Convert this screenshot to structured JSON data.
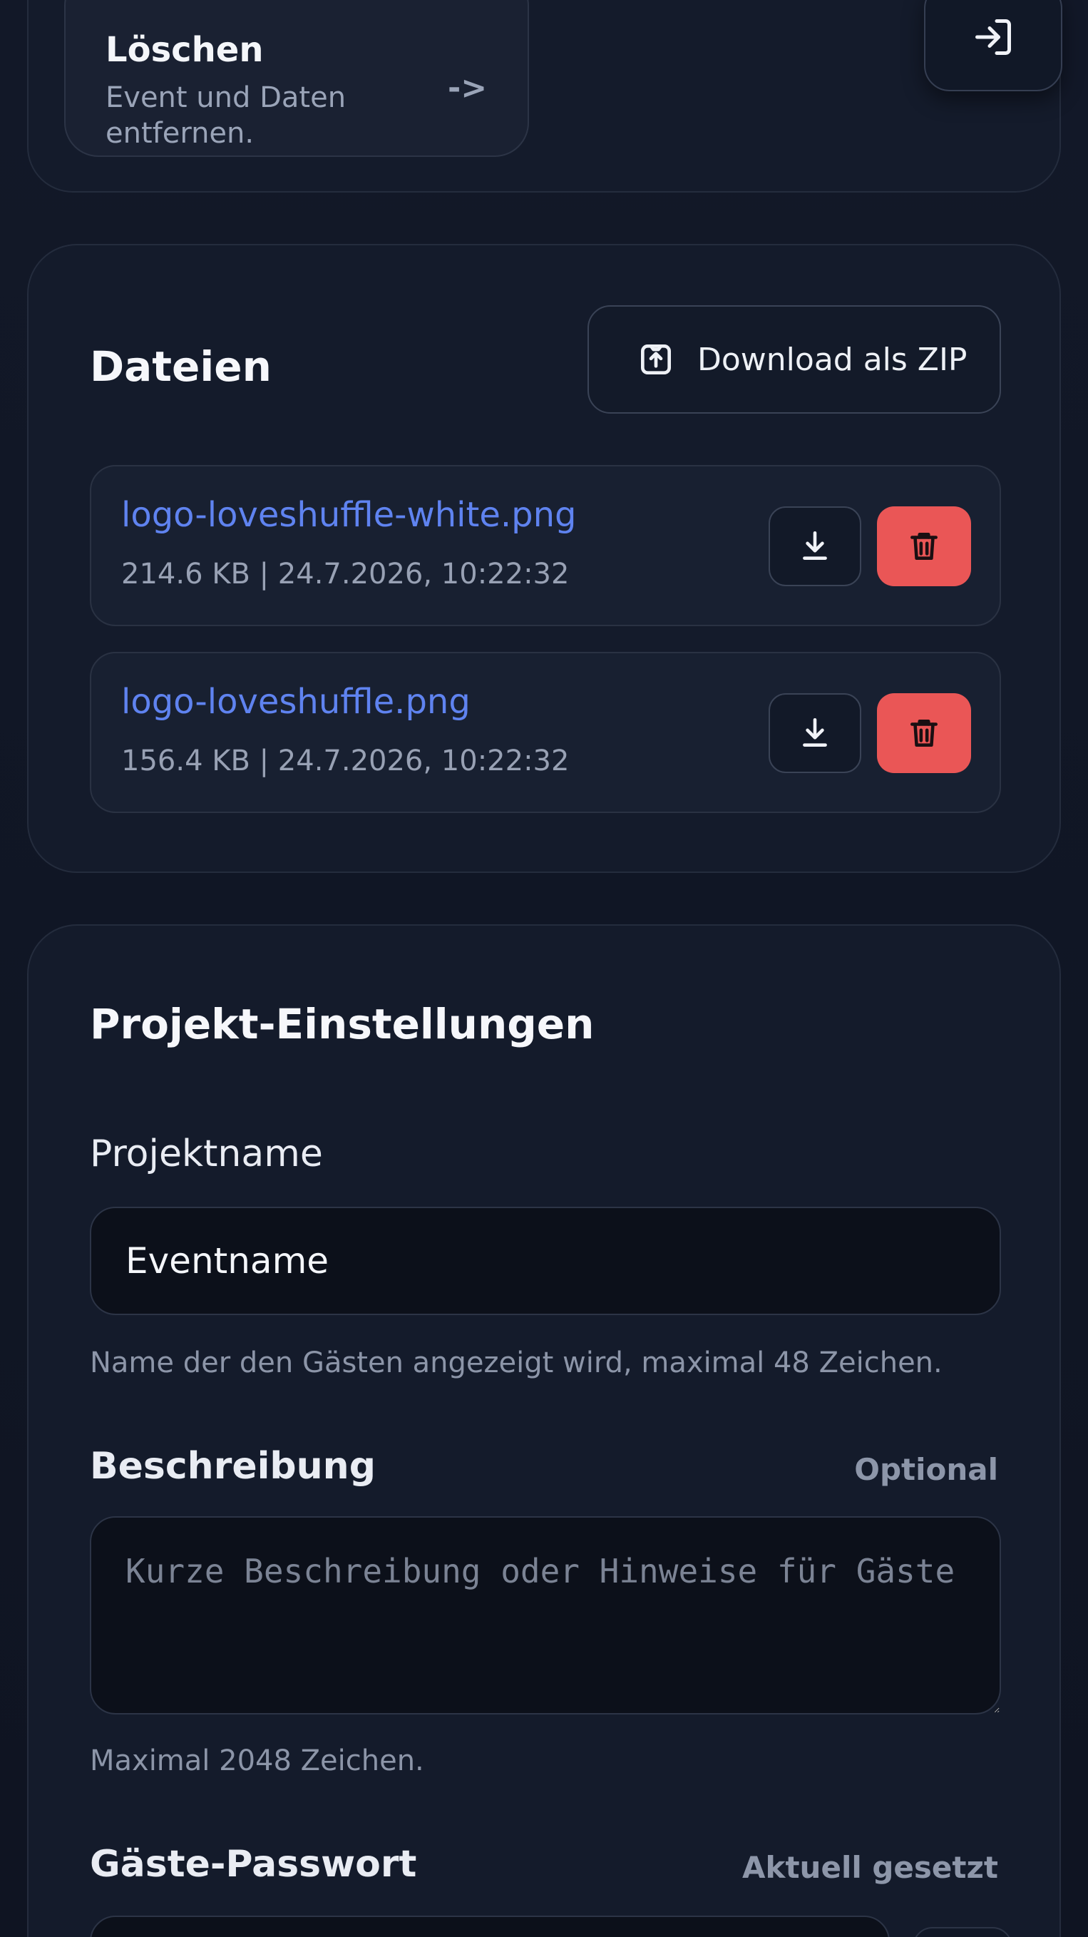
{
  "delete_tile": {
    "title": "Löschen",
    "description": "Event und Daten entfernen.",
    "arrow": "->"
  },
  "logout_button": {
    "icon": "sign-in-icon"
  },
  "files": {
    "title": "Dateien",
    "zip_button_label": "Download als ZIP",
    "zip_icon": "archive-upload-icon",
    "items": [
      {
        "name": "logo-loveshuffle-white.png",
        "meta": "214.6 KB | 24.7.2026, 10:22:32"
      },
      {
        "name": "logo-loveshuffle.png",
        "meta": "156.4 KB | 24.7.2026, 10:22:32"
      }
    ],
    "download_icon": "download-icon",
    "delete_icon": "trash-icon"
  },
  "settings": {
    "title": "Projekt-Einstellungen",
    "project_name": {
      "label": "Projektname",
      "value": "Eventname",
      "hint": "Name der den Gästen angezeigt wird, maximal 48 Zeichen."
    },
    "description": {
      "label": "Beschreibung",
      "aside": "Optional",
      "placeholder": "Kurze Beschreibung oder Hinweise für Gäste",
      "hint": "Maximal 2048 Zeichen."
    },
    "guest_password": {
      "label": "Gäste-Passwort",
      "aside": "Aktuell gesetzt"
    }
  },
  "colors": {
    "background": "#111726",
    "card": "#141b2b",
    "link": "#5f83f0",
    "danger": "#ea5656",
    "muted": "#8c95a8"
  }
}
